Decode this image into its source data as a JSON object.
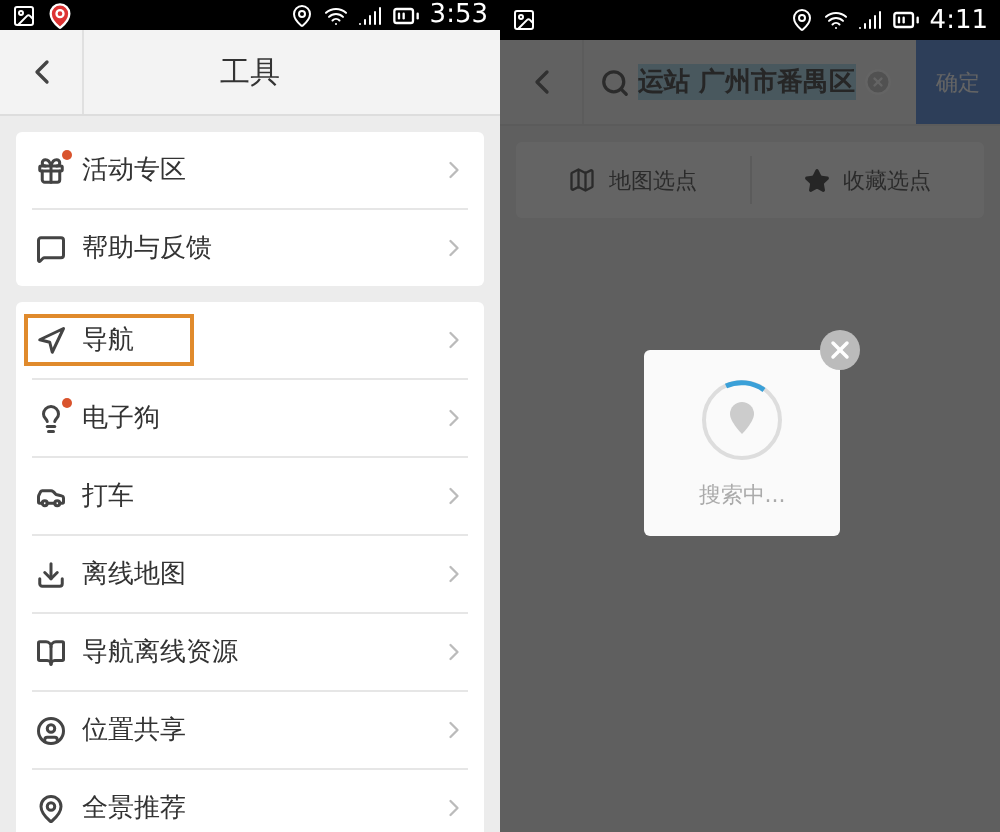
{
  "left_screen": {
    "status_bar": {
      "time": "3:53"
    },
    "header": {
      "title": "工具"
    },
    "groups": [
      [
        {
          "kind": "gift",
          "label": "活动专区",
          "dot": true,
          "highlighted": false
        },
        {
          "kind": "feedback",
          "label": "帮助与反馈",
          "dot": false,
          "highlighted": false
        }
      ],
      [
        {
          "kind": "navigation",
          "label": "导航",
          "dot": false,
          "highlighted": true
        },
        {
          "kind": "dog",
          "label": "电子狗",
          "dot": true,
          "highlighted": false
        },
        {
          "kind": "taxi",
          "label": "打车",
          "dot": false,
          "highlighted": false
        },
        {
          "kind": "download",
          "label": "离线地图",
          "dot": false,
          "highlighted": false
        },
        {
          "kind": "offline",
          "label": "导航离线资源",
          "dot": false,
          "highlighted": false
        },
        {
          "kind": "share",
          "label": "位置共享",
          "dot": false,
          "highlighted": false
        },
        {
          "kind": "panorama",
          "label": "全景推荐",
          "dot": false,
          "highlighted": false
        }
      ]
    ]
  },
  "right_screen": {
    "status_bar": {
      "time": "4:11"
    },
    "search": {
      "value": "运站 广州市番禺区",
      "text_selected": true
    },
    "confirm_button": "确定",
    "tabs": [
      {
        "kind": "map",
        "label": "地图选点"
      },
      {
        "kind": "star",
        "label": "收藏选点"
      }
    ],
    "dialog": {
      "message": "搜索中..."
    }
  }
}
